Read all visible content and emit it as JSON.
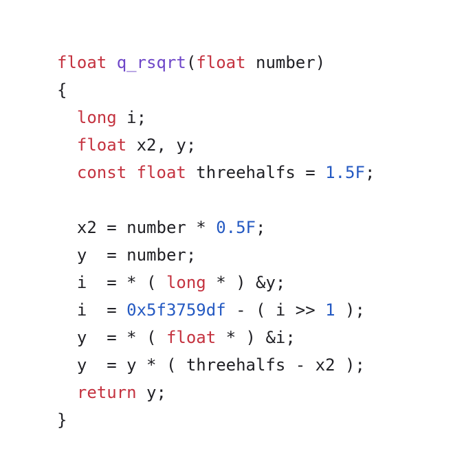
{
  "editor": {
    "language": "C",
    "colors": {
      "background": "#ffffff",
      "plain": "#1f1f24",
      "keyword": "#c4323f",
      "function": "#6e46c8",
      "number": "#2459c2"
    },
    "lines": [
      [
        {
          "t": "float",
          "k": "keyword"
        },
        {
          "t": " ",
          "k": "plain"
        },
        {
          "t": "q_rsqrt",
          "k": "function"
        },
        {
          "t": "(",
          "k": "plain"
        },
        {
          "t": "float",
          "k": "keyword"
        },
        {
          "t": " number)",
          "k": "plain"
        }
      ],
      [
        {
          "t": "{",
          "k": "plain"
        }
      ],
      [
        {
          "t": "  ",
          "k": "plain"
        },
        {
          "t": "long",
          "k": "keyword"
        },
        {
          "t": " i;",
          "k": "plain"
        }
      ],
      [
        {
          "t": "  ",
          "k": "plain"
        },
        {
          "t": "float",
          "k": "keyword"
        },
        {
          "t": " x2, y;",
          "k": "plain"
        }
      ],
      [
        {
          "t": "  ",
          "k": "plain"
        },
        {
          "t": "const",
          "k": "keyword"
        },
        {
          "t": " ",
          "k": "plain"
        },
        {
          "t": "float",
          "k": "keyword"
        },
        {
          "t": " threehalfs = ",
          "k": "plain"
        },
        {
          "t": "1.5F",
          "k": "number"
        },
        {
          "t": ";",
          "k": "plain"
        }
      ],
      [],
      [
        {
          "t": "  x2 = number * ",
          "k": "plain"
        },
        {
          "t": "0.5F",
          "k": "number"
        },
        {
          "t": ";",
          "k": "plain"
        }
      ],
      [
        {
          "t": "  y  = number;",
          "k": "plain"
        }
      ],
      [
        {
          "t": "  i  = * ( ",
          "k": "plain"
        },
        {
          "t": "long",
          "k": "keyword"
        },
        {
          "t": " * ) &y;",
          "k": "plain"
        }
      ],
      [
        {
          "t": "  i  = ",
          "k": "plain"
        },
        {
          "t": "0x5f3759df",
          "k": "number"
        },
        {
          "t": " - ( i >> ",
          "k": "plain"
        },
        {
          "t": "1",
          "k": "number"
        },
        {
          "t": " );",
          "k": "plain"
        }
      ],
      [
        {
          "t": "  y  = * ( ",
          "k": "plain"
        },
        {
          "t": "float",
          "k": "keyword"
        },
        {
          "t": " * ) &i;",
          "k": "plain"
        }
      ],
      [
        {
          "t": "  y  = y * ( threehalfs - x2 );",
          "k": "plain"
        }
      ],
      [
        {
          "t": "  ",
          "k": "plain"
        },
        {
          "t": "return",
          "k": "keyword"
        },
        {
          "t": " y;",
          "k": "plain"
        }
      ],
      [
        {
          "t": "}",
          "k": "plain"
        }
      ]
    ]
  }
}
